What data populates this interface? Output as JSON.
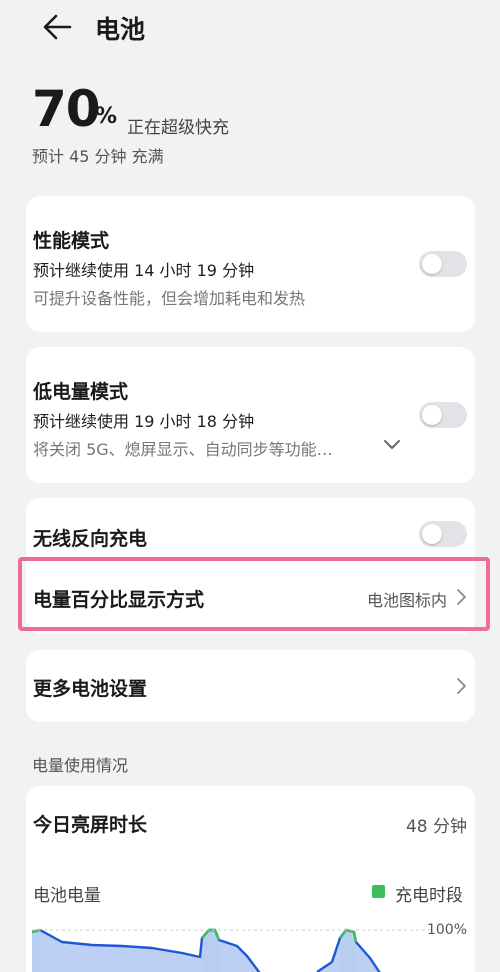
{
  "header": {
    "title": "电池"
  },
  "battery": {
    "percent": "70",
    "percent_sign": "%",
    "status": "正在超级快充",
    "full_time": "预计 45 分钟 充满"
  },
  "performance_mode": {
    "title": "性能模式",
    "estimate": "预计继续使用 14 小时 19 分钟",
    "description": "可提升设备性能，但会增加耗电和发热",
    "enabled": false
  },
  "low_power_mode": {
    "title": "低电量模式",
    "estimate": "预计继续使用 19 小时 18 分钟",
    "description": "将关闭 5G、熄屏显示、自动同步等功能…",
    "enabled": false
  },
  "wireless_reverse": {
    "title": "无线反向充电",
    "enabled": false
  },
  "percentage_display": {
    "title": "电量百分比显示方式",
    "value": "电池图标内"
  },
  "more_settings": {
    "title": "更多电池设置"
  },
  "usage": {
    "section_label": "电量使用情况",
    "screen_on_label": "今日亮屏时长",
    "screen_on_value": "48 分钟",
    "battery_level_label": "电池电量",
    "legend_charging": "充电时段",
    "y_max_label": "100%"
  },
  "colors": {
    "highlight": "#ee6d95",
    "charging": "#3cbe58",
    "line": "#1e57d6",
    "fill": "#b9cdf3"
  }
}
